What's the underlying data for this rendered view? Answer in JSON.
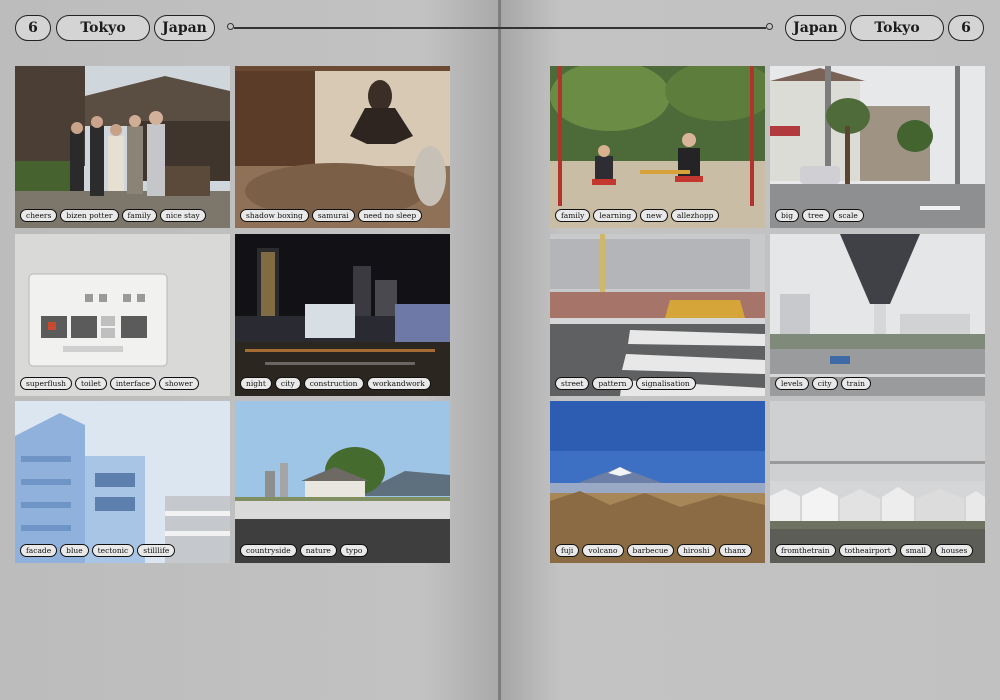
{
  "spread": {
    "left_page": {
      "page_number": "6",
      "city": "Tokyo",
      "country": "Japan"
    },
    "right_page": {
      "page_number": "6",
      "city": "Tokyo",
      "country": "Japan"
    }
  },
  "photos": [
    {
      "tags": [
        "cheers",
        "bizen potter",
        "family",
        "nice stay"
      ]
    },
    {
      "tags": [
        "shadow boxing",
        "samurai",
        "need no sleep"
      ]
    },
    {
      "tags": [
        "superflush",
        "toilet",
        "interface",
        "shower"
      ]
    },
    {
      "tags": [
        "night",
        "city",
        "construction",
        "workandwork"
      ]
    },
    {
      "tags": [
        "facade",
        "blue",
        "tectonic",
        "stilllife"
      ]
    },
    {
      "tags": [
        "countryside",
        "nature",
        "typo"
      ]
    },
    {
      "tags": [
        "family",
        "learning",
        "new",
        "allezhopp"
      ]
    },
    {
      "tags": [
        "big",
        "tree",
        "scale"
      ]
    },
    {
      "tags": [
        "street",
        "pattern",
        "signalisation"
      ]
    },
    {
      "tags": [
        "levels",
        "city",
        "train"
      ]
    },
    {
      "tags": [
        "fuji",
        "volcano",
        "barbecue",
        "hiroshi",
        "thanx"
      ]
    },
    {
      "tags": [
        "fromthetrain",
        "totheairport",
        "small",
        "houses"
      ]
    }
  ]
}
